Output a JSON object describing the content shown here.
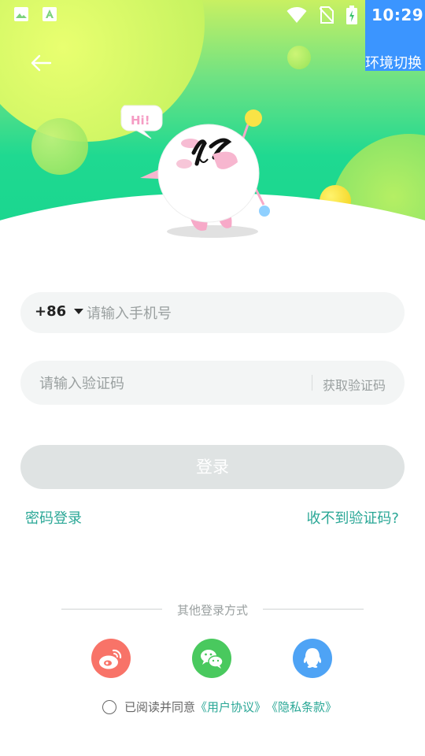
{
  "status_bar": {
    "time": "10:29"
  },
  "env_switch": {
    "label": "环境切换"
  },
  "phone": {
    "country_code": "+86",
    "placeholder": "请输入手机号"
  },
  "code": {
    "placeholder": "请输入验证码",
    "get_code_label": "获取验证码"
  },
  "login_button": "登录",
  "links": {
    "password_login": "密码登录",
    "no_code": "收不到验证码?"
  },
  "other_login": {
    "title": "其他登录方式",
    "providers": [
      "weibo-icon",
      "wechat-icon",
      "qq-icon"
    ]
  },
  "agreement": {
    "prefix": "已阅读并同意",
    "user_agreement": "《用户协议》",
    "privacy_policy": "《隐私条款》"
  },
  "mascot": {
    "speech": "Hi!"
  },
  "colors": {
    "accent": "#2aa796",
    "env_switch": "#3b95ff",
    "weibo": "#f87368",
    "wechat": "#49c95e",
    "qq": "#4ea3f5",
    "hero_top": "#c8f062",
    "hero_bottom": "#18d58e"
  }
}
